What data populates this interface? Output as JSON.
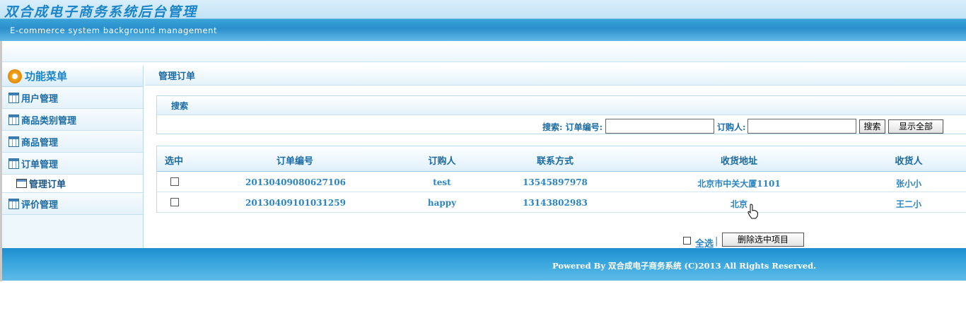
{
  "header": {
    "cn_title": "双合成电子商务系统后台管理",
    "en_title": "E-commerce system background management"
  },
  "sidebar": {
    "title": "功能菜单",
    "title_icon": "gear-icon",
    "items": [
      {
        "label": "用户管理",
        "icon": "table-icon"
      },
      {
        "label": "商品类别管理",
        "icon": "table-icon"
      },
      {
        "label": "商品管理",
        "icon": "table-icon"
      },
      {
        "label": "订单管理",
        "icon": "table-icon"
      },
      {
        "label": "评价管理",
        "icon": "table-icon"
      }
    ],
    "sub_items": [
      {
        "label": "管理订单",
        "icon": "window-icon"
      }
    ]
  },
  "main": {
    "breadcrumb": "管理订单",
    "search": {
      "title": "搜索",
      "order_no_label": "搜索: 订单编号:",
      "order_no_value": "",
      "buyer_label": "订购人:",
      "buyer_value": "",
      "search_button": "搜索",
      "show_all_button": "显示全部"
    },
    "table": {
      "columns": [
        "选中",
        "订单编号",
        "订购人",
        "联系方式",
        "收货地址",
        "收货人"
      ],
      "rows": [
        {
          "order_no": "20130409080627106",
          "buyer": "test",
          "contact": "13545897978",
          "address": "北京市中关大厦1101",
          "receiver": "张小小"
        },
        {
          "order_no": "20130409101031259",
          "buyer": "happy",
          "contact": "13143802983",
          "address": "北京",
          "receiver": "王二小"
        }
      ]
    },
    "actions": {
      "select_all": "全选",
      "separator": "|",
      "delete_button": "删除选中项目"
    }
  },
  "footer": {
    "text": "Powered By 双合成电子商务系统  (C)2013 All Rights Reserved."
  }
}
